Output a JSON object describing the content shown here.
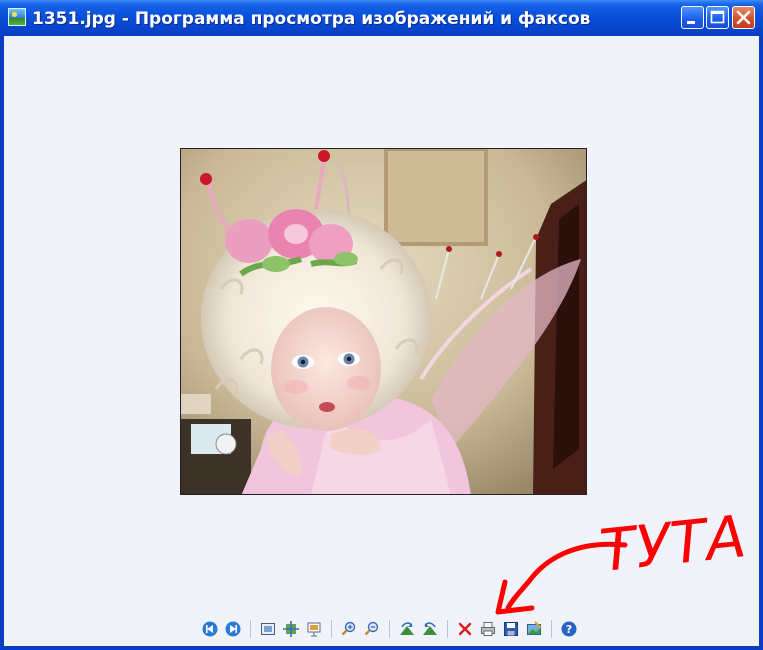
{
  "window": {
    "title": "1351.jpg - Программа просмотра изображений и факсов"
  },
  "annotation": {
    "text": "ТУТА",
    "color": "#ff0000"
  },
  "colors": {
    "titlebar": "#0a52dc",
    "client_bg": "#f0f3fa",
    "frame": "#0a3fc4"
  },
  "toolbar": {
    "icons": [
      "previous-image-icon",
      "next-image-icon",
      "best-fit-icon",
      "actual-size-icon",
      "slideshow-icon",
      "zoom-in-icon",
      "zoom-out-icon",
      "rotate-clockwise-icon",
      "rotate-counterclockwise-icon",
      "delete-icon",
      "print-icon",
      "save-icon",
      "edit-icon",
      "help-icon"
    ]
  }
}
